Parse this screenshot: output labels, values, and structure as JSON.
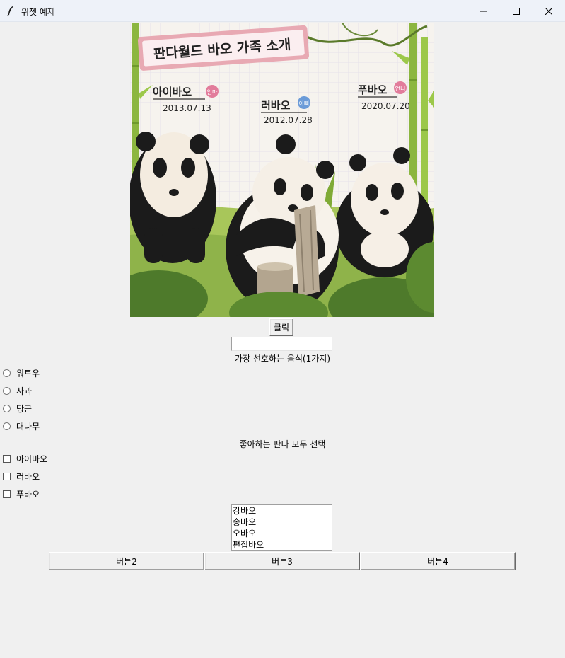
{
  "window": {
    "title": "위젯 예제",
    "minimize_glyph": "—",
    "maximize_glyph": "☐",
    "close_glyph": "✕"
  },
  "image": {
    "banner": "판다월드 바오 가족 소개",
    "pandas": [
      {
        "name": "아이바오",
        "role": "엄마",
        "date": "2013.07.13"
      },
      {
        "name": "러바오",
        "role": "아빠",
        "date": "2012.07.28"
      },
      {
        "name": "푸바오",
        "role": "언니",
        "date": "2020.07.20"
      }
    ]
  },
  "click_button": {
    "label": "클릭"
  },
  "entry": {
    "value": ""
  },
  "food_section": {
    "label": "가장 선호하는 음식(1가지)",
    "options": [
      "워토우",
      "사과",
      "당근",
      "대나무"
    ]
  },
  "panda_section": {
    "label": "좋아하는 판다 모두 선택",
    "options": [
      "아이바오",
      "러바오",
      "푸바오"
    ]
  },
  "listbox": {
    "items": [
      "강바오",
      "송바오",
      "오바오",
      "편집바오"
    ]
  },
  "bottom_buttons": [
    "버튼2",
    "버튼3",
    "버튼4"
  ]
}
